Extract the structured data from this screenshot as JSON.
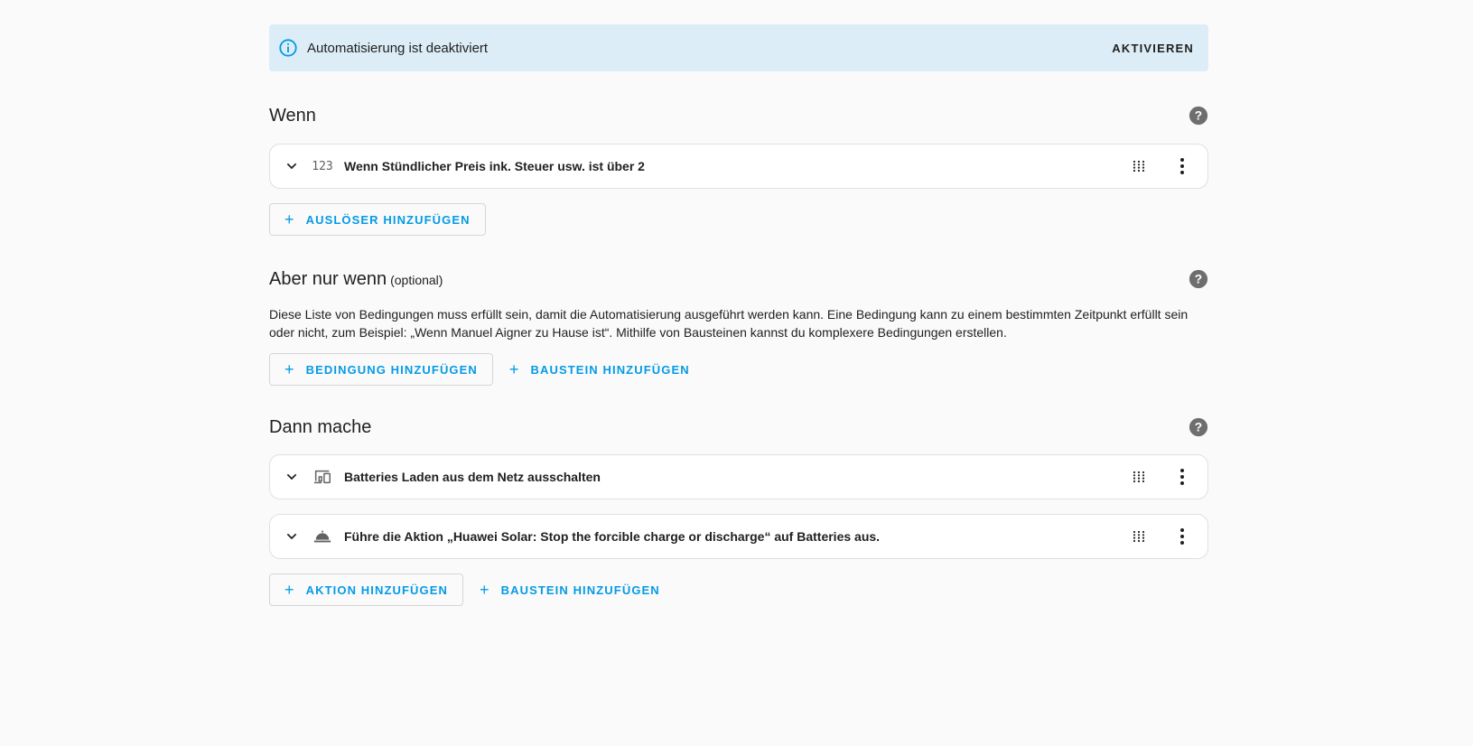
{
  "banner": {
    "text": "Automatisierung ist deaktiviert",
    "action_label": "AKTIVIEREN"
  },
  "triggers": {
    "title": "Wenn",
    "items": [
      {
        "icon": "numeric-icon",
        "icon_text": "123",
        "label": "Wenn Stündlicher Preis ink. Steuer usw. ist über 2"
      }
    ],
    "add_label": "AUSLÖSER HINZUFÜGEN"
  },
  "conditions": {
    "title": "Aber nur wenn",
    "optional": "(optional)",
    "description": "Diese Liste von Bedingungen muss erfüllt sein, damit die Automatisierung ausgeführt werden kann. Eine Bedingung kann zu einem bestimmten Zeitpunkt erfüllt sein oder nicht, zum Beispiel: „Wenn Manuel Aigner zu Hause ist“. Mithilfe von Bausteinen kannst du komplexere Bedingungen erstellen.",
    "add_label": "BEDINGUNG HINZUFÜGEN",
    "building_block_label": "BAUSTEIN HINZUFÜGEN"
  },
  "actions": {
    "title": "Dann mache",
    "items": [
      {
        "icon": "devices-icon",
        "label": "Batteries Laden aus dem Netz ausschalten"
      },
      {
        "icon": "room-service-icon",
        "label": "Führe die Aktion „Huawei Solar: Stop the forcible charge or discharge“ auf Batteries aus."
      }
    ],
    "add_label": "AKTION HINZUFÜGEN",
    "building_block_label": "BAUSTEIN HINZUFÜGEN"
  },
  "colors": {
    "accent": "#039be5",
    "banner_bg": "#dcedf7",
    "background": "#fafafa",
    "icon_gray": "#616161"
  }
}
